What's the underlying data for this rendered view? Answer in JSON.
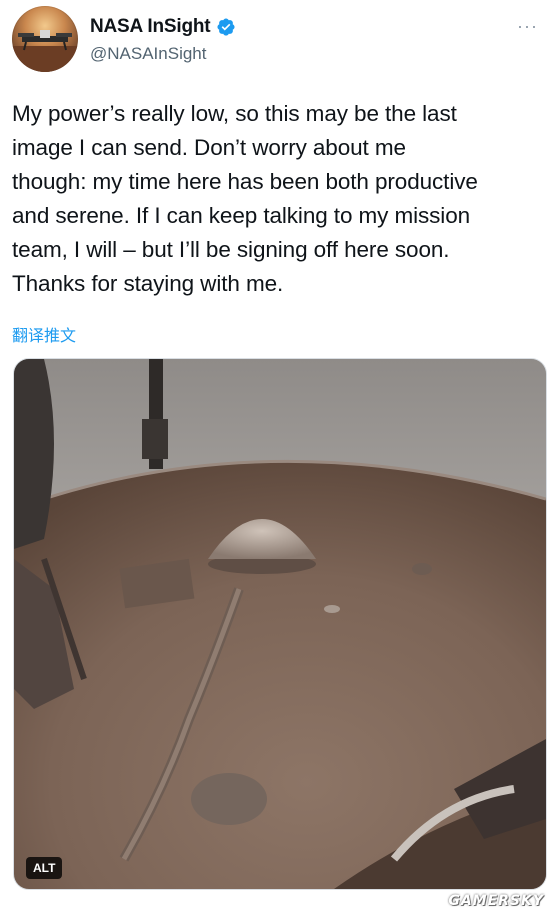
{
  "author": {
    "display_name": "NASA InSight",
    "handle": "@NASAInSight",
    "verified_icon": "verified-badge-icon",
    "accent_color": "#1d9bf0"
  },
  "more_icon": "more-options-icon",
  "tweet": {
    "text": "My power’s really low, so this may be the last\nimage I can send. Don’t worry about me\nthough: my time here has been both productive\nand serene. If I can keep talking to my mission\nteam, I will – but I’ll be signing off here soon.\nThanks for staying with me."
  },
  "translate_label": "翻译推文",
  "media": {
    "alt_label": "ALT"
  },
  "watermark": "GAMERSKY"
}
